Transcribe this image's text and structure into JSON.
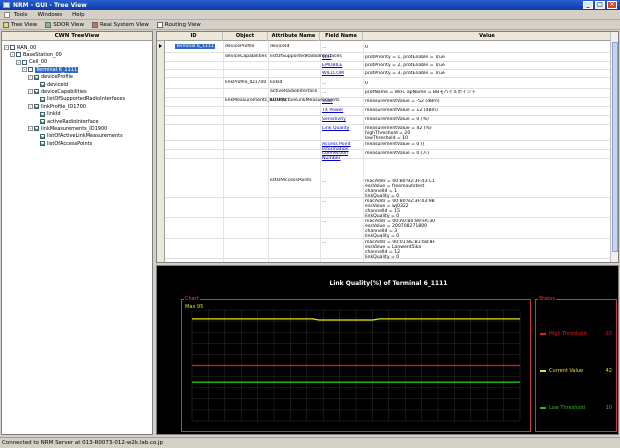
{
  "window": {
    "title": "NRM - GUI - Tree View"
  },
  "menu": {
    "items": [
      "Tools",
      "Windows",
      "Help"
    ]
  },
  "toolbar": {
    "buttons": [
      "Tree View",
      "SDOR View",
      "Real System View",
      "Routing View"
    ]
  },
  "tree": {
    "header": "CWN TreeView",
    "nodes": [
      {
        "label": "RAN_00",
        "expand": "-",
        "check": false,
        "selected": false
      },
      {
        "label": "BaseStation_00",
        "expand": "-",
        "check": false,
        "selected": false
      },
      {
        "label": "Cell_00",
        "expand": "-",
        "check": false,
        "selected": false
      },
      {
        "label": "Terminal 6_1111",
        "expand": "-",
        "check": false,
        "selected": true
      },
      {
        "label": "deviceProfile",
        "expand": "-",
        "check": true,
        "selected": false
      },
      {
        "label": "deviceId",
        "expand": "",
        "check": true,
        "selected": false
      },
      {
        "label": "deviceCapabilities",
        "expand": "-",
        "check": true,
        "selected": false
      },
      {
        "label": "listOfSupportedRadioInterfaces",
        "expand": "",
        "check": true,
        "selected": false
      },
      {
        "label": "linkProfile_ID1700",
        "expand": "-",
        "check": true,
        "selected": false
      },
      {
        "label": "linkId",
        "expand": "",
        "check": true,
        "selected": false
      },
      {
        "label": "activeRadioInterface",
        "expand": "",
        "check": true,
        "selected": false
      },
      {
        "label": "linkMeasurements_ID1900",
        "expand": "-",
        "check": true,
        "selected": false
      },
      {
        "label": "listOfActiveLinkMeasurements",
        "expand": "",
        "check": true,
        "selected": false
      },
      {
        "label": "listOfAccessPoints",
        "expand": "",
        "check": true,
        "selected": false
      }
    ]
  },
  "grid": {
    "columns": [
      "ID",
      "Object",
      "Attribute Name",
      "Field Name",
      "Value"
    ],
    "cells": {
      "id": "Terminal 6_1111",
      "obj_deviceprofile": "deviceProfile",
      "obj_devicecap": "deviceCapabilities",
      "obj_linkprofile": "linkProfile_ID1700",
      "obj_linkmeas": "linkMeasurements_ID1900",
      "attr_deviceid": "deviceId",
      "attr_listsupported": "listOfSupportedRadioInterfaces",
      "attr_linkid": "linkId",
      "attr_activeradio": "activeRadioInterface",
      "attr_listactive": "listOfActiveLinkMeasurements",
      "attr_listap": "listOfAccessPoints"
    },
    "rows": [
      {
        "field": "...",
        "link": false,
        "value": "0"
      },
      {
        "field": "WiFi",
        "link": true,
        "value": "protPriority = 1, protEnable = True"
      },
      {
        "field": "EMOBILE",
        "link": true,
        "value": "protPriority = 2, protEnable = True"
      },
      {
        "field": "WILLCOM",
        "link": true,
        "value": "protPriority = 3, protEnable = True"
      },
      {
        "field": "...",
        "link": false,
        "value": "0"
      },
      {
        "field": "...",
        "link": false,
        "value": "protName = WiFi, apName = BBモバイルポイント"
      },
      {
        "field": "SSID",
        "link": true,
        "value": "measurementValue = -52 (dBm)"
      },
      {
        "field": "TX Power",
        "link": true,
        "value": "measurementValue = 12 (dBm)"
      },
      {
        "field": "Sensitivity",
        "link": true,
        "value": "measurementValue = 0 (%)"
      },
      {
        "field": "Link Quality",
        "link": true,
        "value": "measurementValue = 42 (%)\nhighThreshold = 20\nlowThreshold = 10"
      },
      {
        "field": "Access Point Information",
        "link": true,
        "value": "measurementValue = 0 ()"
      },
      {
        "field": "Connection Number",
        "link": true,
        "value": "measurementValue = 0 (人)"
      },
      {
        "field": "...",
        "link": false,
        "value": "macAddr = 00:80:92:3F:43:C1\nessValue = freemoutstest\nchannelId = 1\nlinkQuality = 0"
      },
      {
        "field": "...",
        "link": false,
        "value": "macAddr = 00:80:92:3F:43:98\nessValue = wj0322\nchannelId = 15\nlinkQuality = 0"
      },
      {
        "field": "...",
        "link": false,
        "value": "macAddr = 00:A0:B0:89:FA:30\nessValue = 200708271800\nchannelId = 3\nlinkQuality = 0"
      },
      {
        "field": "...",
        "link": false,
        "value": "macAddr = 00:01:8E:B1:68:8F\nessValue = Lanwent5ika\nchannelId = 12\nlinkQuality = 0"
      }
    ]
  },
  "chart_data": {
    "type": "line",
    "title": "Link Quality(%) of Terminal 6_1111",
    "legend_label": "Chart",
    "series": [
      {
        "name": "Current Value",
        "color": "#e8e020",
        "values": [
          92,
          92,
          92,
          92,
          92,
          92,
          92,
          92,
          92,
          92,
          92,
          92,
          92,
          92,
          92,
          92,
          92,
          92,
          92,
          91,
          91,
          91,
          91,
          91,
          91,
          91,
          91,
          91,
          92,
          92,
          92,
          92,
          92,
          92,
          92,
          92,
          92,
          92,
          92,
          92,
          92,
          92,
          92,
          92,
          92,
          92,
          92,
          92,
          92,
          92
        ]
      },
      {
        "name": "High Threshold",
        "color": "#e02020",
        "values": [
          50,
          50,
          50,
          50,
          50,
          50,
          50,
          50,
          50,
          50,
          50,
          50,
          50,
          50,
          50,
          50,
          50,
          50,
          50,
          50,
          50,
          50,
          50,
          50,
          50,
          50,
          50,
          50,
          50,
          50,
          50,
          50,
          50,
          50,
          50,
          50,
          50,
          50,
          50,
          50,
          50,
          50,
          50,
          50,
          50,
          50,
          50,
          50,
          50,
          50
        ]
      },
      {
        "name": "Low Threshold",
        "color": "#20c020",
        "values": [
          35,
          35,
          35,
          35,
          35,
          35,
          35,
          35,
          35,
          35,
          35,
          35,
          35,
          35,
          35,
          35,
          35,
          35,
          35,
          35,
          35,
          35,
          35,
          35,
          35,
          35,
          35,
          35,
          35,
          35,
          35,
          35,
          35,
          35,
          35,
          35,
          35,
          35,
          35,
          35,
          35,
          35,
          35,
          35,
          35,
          35,
          35,
          35,
          35,
          35
        ]
      }
    ],
    "ylim": [
      0,
      100
    ],
    "top_label": "Max 95",
    "grid": true
  },
  "status_panel": {
    "title": "Status",
    "rows": [
      {
        "name": "High Threshold",
        "value": "20",
        "color": "#e02020"
      },
      {
        "name": "Current Value",
        "value": "42",
        "color": "#e8e020"
      },
      {
        "name": "Low Threshold",
        "value": "10",
        "color": "#20c020"
      }
    ]
  },
  "statusbar": {
    "text": "Connected to NRM Server at 013-R0073-012-w2k.lab.co.jp"
  }
}
